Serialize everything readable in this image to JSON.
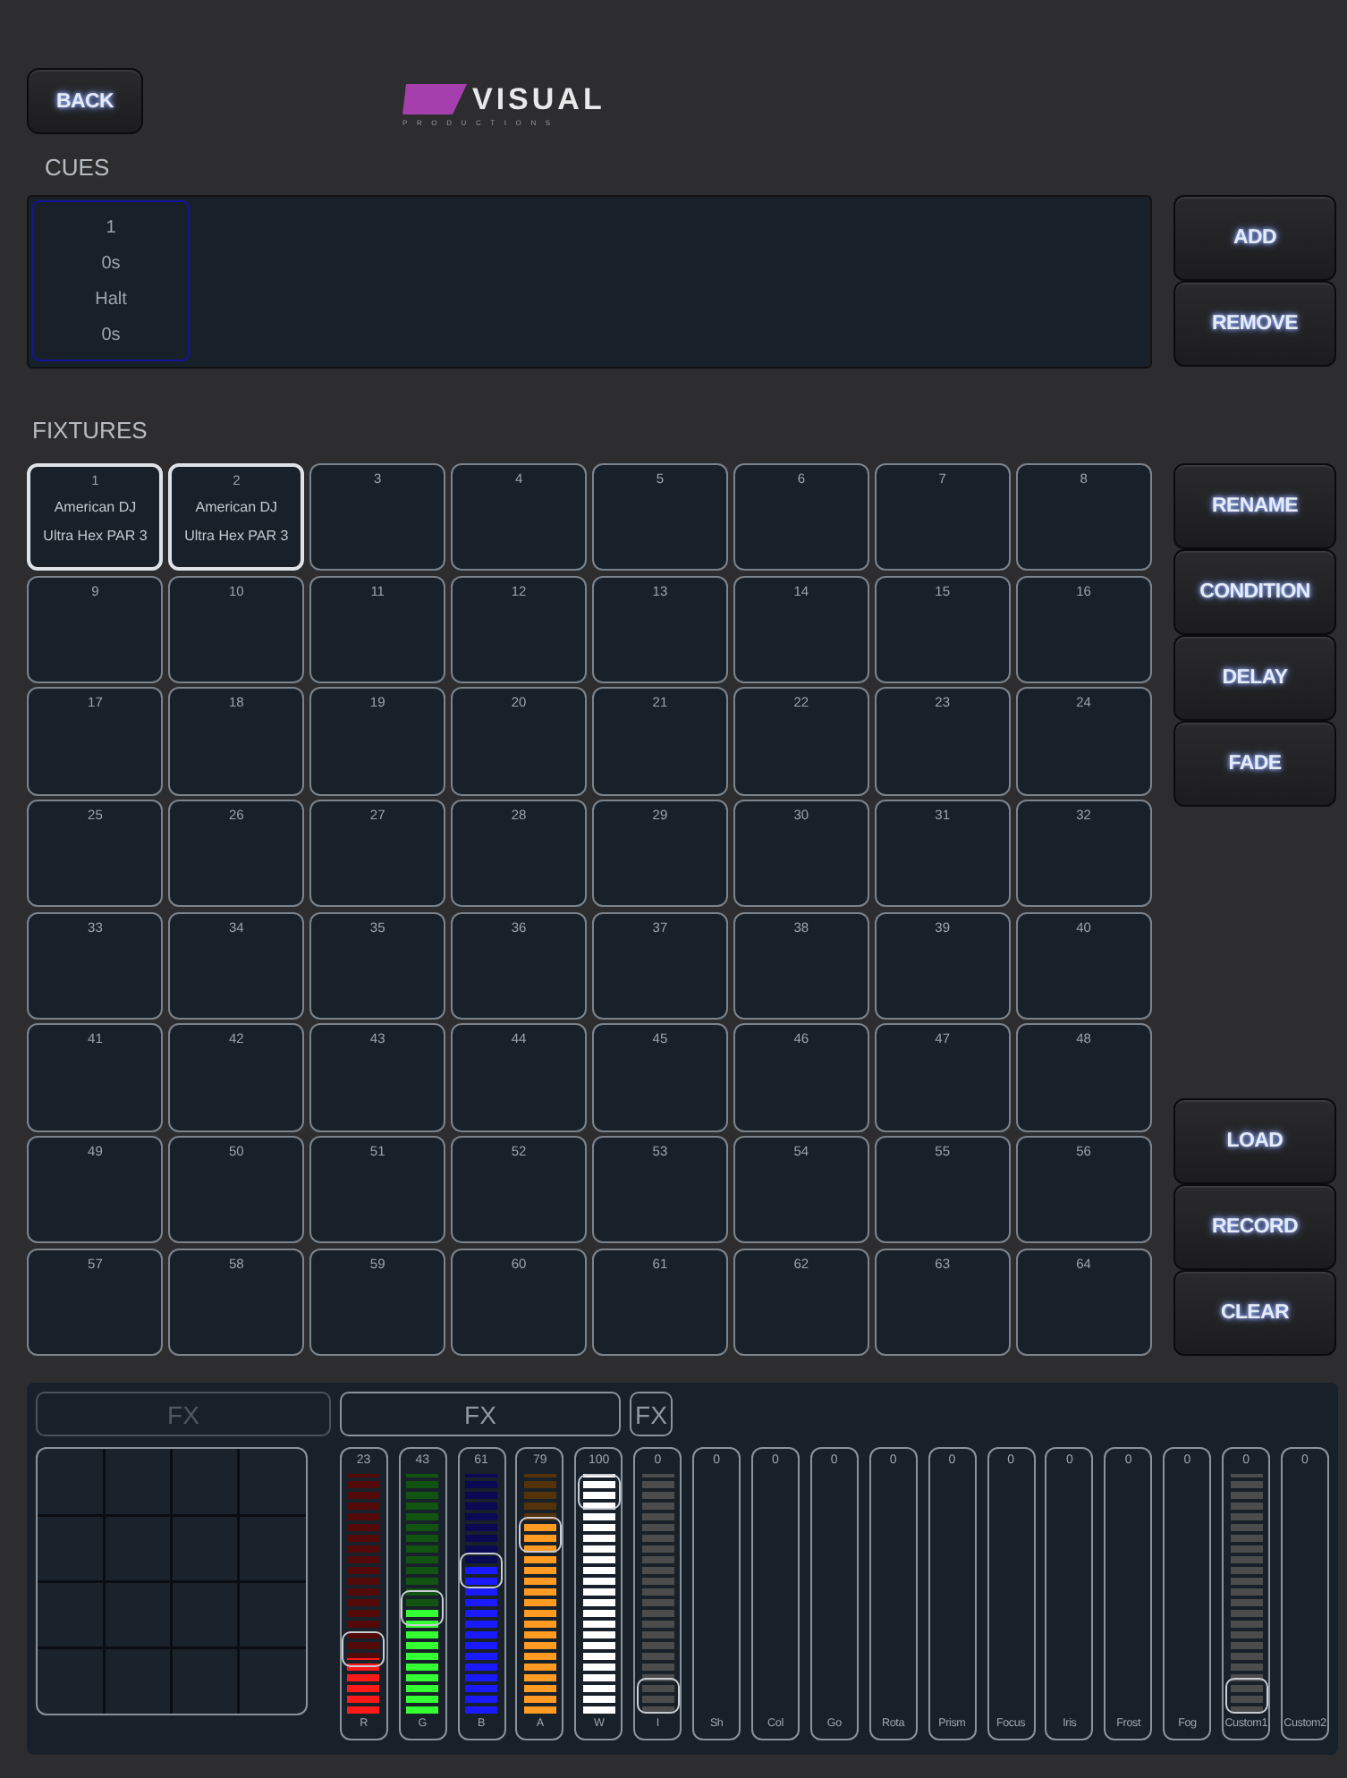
{
  "header": {
    "back_button": "BACK",
    "logo": {
      "title": "VISUAL",
      "subtitle": "PRODUCTIONS"
    }
  },
  "cues": {
    "title": "CUES",
    "items": [
      {
        "lines": [
          "1",
          "0s",
          "Halt",
          "0s"
        ],
        "selected": true
      }
    ],
    "buttons": [
      "ADD",
      "REMOVE"
    ]
  },
  "fixtures": {
    "title": "FIXTURES",
    "buttons_top": [
      "RENAME",
      "CONDITION",
      "DELAY",
      "FADE"
    ],
    "buttons_bottom": [
      "LOAD",
      "RECORD",
      "CLEAR"
    ],
    "items": [
      {
        "number": "1",
        "lines": [
          "American DJ",
          "Ultra Hex PAR 3"
        ],
        "selected": true
      },
      {
        "number": "2",
        "lines": [
          "American DJ",
          "Ultra Hex PAR 3"
        ],
        "selected": true
      },
      {
        "number": "3",
        "selected": false
      },
      {
        "number": "4",
        "selected": false
      },
      {
        "number": "5",
        "selected": false
      },
      {
        "number": "6",
        "selected": false
      },
      {
        "number": "7",
        "selected": false
      },
      {
        "number": "8",
        "selected": false
      },
      {
        "number": "9",
        "selected": false
      },
      {
        "number": "10",
        "selected": false
      },
      {
        "number": "11",
        "selected": false
      },
      {
        "number": "12",
        "selected": false
      },
      {
        "number": "13",
        "selected": false
      },
      {
        "number": "14",
        "selected": false
      },
      {
        "number": "15",
        "selected": false
      },
      {
        "number": "16",
        "selected": false
      },
      {
        "number": "17",
        "selected": false
      },
      {
        "number": "18",
        "selected": false
      },
      {
        "number": "19",
        "selected": false
      },
      {
        "number": "20",
        "selected": false
      },
      {
        "number": "21",
        "selected": false
      },
      {
        "number": "22",
        "selected": false
      },
      {
        "number": "23",
        "selected": false
      },
      {
        "number": "24",
        "selected": false
      },
      {
        "number": "25",
        "selected": false
      },
      {
        "number": "26",
        "selected": false
      },
      {
        "number": "27",
        "selected": false
      },
      {
        "number": "28",
        "selected": false
      },
      {
        "number": "29",
        "selected": false
      },
      {
        "number": "30",
        "selected": false
      },
      {
        "number": "31",
        "selected": false
      },
      {
        "number": "32",
        "selected": false
      },
      {
        "number": "33",
        "selected": false
      },
      {
        "number": "34",
        "selected": false
      },
      {
        "number": "35",
        "selected": false
      },
      {
        "number": "36",
        "selected": false
      },
      {
        "number": "37",
        "selected": false
      },
      {
        "number": "38",
        "selected": false
      },
      {
        "number": "39",
        "selected": false
      },
      {
        "number": "40",
        "selected": false
      },
      {
        "number": "41",
        "selected": false
      },
      {
        "number": "42",
        "selected": false
      },
      {
        "number": "43",
        "selected": false
      },
      {
        "number": "44",
        "selected": false
      },
      {
        "number": "45",
        "selected": false
      },
      {
        "number": "46",
        "selected": false
      },
      {
        "number": "47",
        "selected": false
      },
      {
        "number": "48",
        "selected": false
      },
      {
        "number": "49",
        "selected": false
      },
      {
        "number": "50",
        "selected": false
      },
      {
        "number": "51",
        "selected": false
      },
      {
        "number": "52",
        "selected": false
      },
      {
        "number": "53",
        "selected": false
      },
      {
        "number": "54",
        "selected": false
      },
      {
        "number": "55",
        "selected": false
      },
      {
        "number": "56",
        "selected": false
      },
      {
        "number": "57",
        "selected": false
      },
      {
        "number": "58",
        "selected": false
      },
      {
        "number": "59",
        "selected": false
      },
      {
        "number": "60",
        "selected": false
      },
      {
        "number": "61",
        "selected": false
      },
      {
        "number": "62",
        "selected": false
      },
      {
        "number": "63",
        "selected": false
      },
      {
        "number": "64",
        "selected": false
      }
    ]
  },
  "controls": {
    "fx_tabs": [
      {
        "label": "FX",
        "disabled": true,
        "kind": "wide"
      },
      {
        "label": "FX",
        "disabled": false,
        "kind": "wide"
      },
      {
        "label": "FX",
        "disabled": false,
        "kind": "small"
      }
    ],
    "faders": [
      {
        "kind": "color",
        "value": "23",
        "label": "R",
        "level": 0.23,
        "color": "#ff1a1a"
      },
      {
        "kind": "color",
        "value": "43",
        "label": "G",
        "level": 0.43,
        "color": "#33ff33"
      },
      {
        "kind": "color",
        "value": "61",
        "label": "B",
        "level": 0.61,
        "color": "#1a1aff"
      },
      {
        "kind": "color",
        "value": "79",
        "label": "A",
        "level": 0.79,
        "color": "#ff9a22"
      },
      {
        "kind": "color",
        "value": "100",
        "label": "W",
        "level": 1,
        "color": "#ffffff"
      },
      {
        "kind": "plain",
        "value": "0",
        "label": "I",
        "level": 0
      },
      {
        "kind": "empty",
        "value": "0",
        "label": "Sh"
      },
      {
        "kind": "empty",
        "value": "0",
        "label": "Col"
      },
      {
        "kind": "empty",
        "value": "0",
        "label": "Go"
      },
      {
        "kind": "empty",
        "value": "0",
        "label": "Rota"
      },
      {
        "kind": "empty",
        "value": "0",
        "label": "Prism"
      },
      {
        "kind": "empty",
        "value": "0",
        "label": "Focus"
      },
      {
        "kind": "empty",
        "value": "0",
        "label": "Iris"
      },
      {
        "kind": "empty",
        "value": "0",
        "label": "Frost"
      },
      {
        "kind": "empty",
        "value": "0",
        "label": "Fog"
      },
      {
        "kind": "plain",
        "value": "0",
        "label": "Custom1",
        "level": 0
      },
      {
        "kind": "empty",
        "value": "0",
        "label": "Custom2"
      }
    ]
  }
}
